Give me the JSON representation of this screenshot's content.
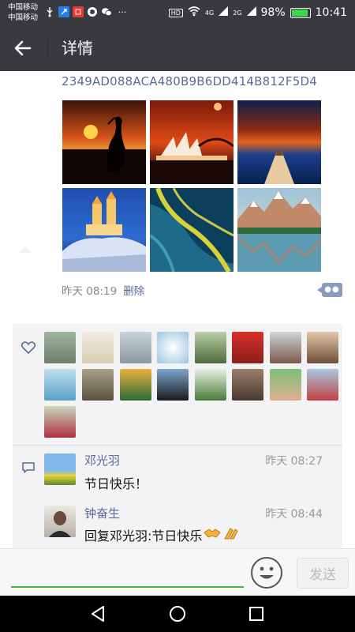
{
  "status_bar": {
    "carrier_1": "中国移动",
    "carrier_2": "中国移动",
    "hd": "HD",
    "network_1": "4G",
    "network_2": "2G",
    "battery": "98%",
    "time": "10:41",
    "notification_icons": [
      "usb-icon",
      "app-icon",
      "news-icon",
      "qq-icon",
      "wechat-icon",
      "more-icon"
    ],
    "more": "···"
  },
  "header": {
    "title": "详情",
    "back_icon": "arrow-left-icon"
  },
  "post": {
    "hash_text": "2349AD088ACA480B9B6DD414B812F5D4",
    "photos": [
      {
        "name": "photo-crane-sunset"
      },
      {
        "name": "photo-opera-house"
      },
      {
        "name": "photo-pier-dusk"
      },
      {
        "name": "photo-white-village"
      },
      {
        "name": "photo-aerial-river"
      },
      {
        "name": "photo-mountain-lake"
      }
    ],
    "time": "昨天 08:19",
    "delete_label": "删除",
    "more_icon": "comment-more-icon"
  },
  "likes": {
    "icon": "heart-icon",
    "avatar_count": 17
  },
  "comments": [
    {
      "name": "邓光羽",
      "time": "昨天 08:27",
      "text": "节日快乐！"
    },
    {
      "name": "钟奋生",
      "time": "昨天 08:44",
      "text": "回复邓光羽:节日快乐"
    }
  ],
  "comment_emojis": [
    "handshake-icon",
    "clap-icon"
  ],
  "input_bar": {
    "emoji_icon": "smiley-icon",
    "send_label": "发送"
  },
  "colors": {
    "titlebar": "#393a3f",
    "link": "#576b95",
    "accent_green": "#46b34b"
  }
}
